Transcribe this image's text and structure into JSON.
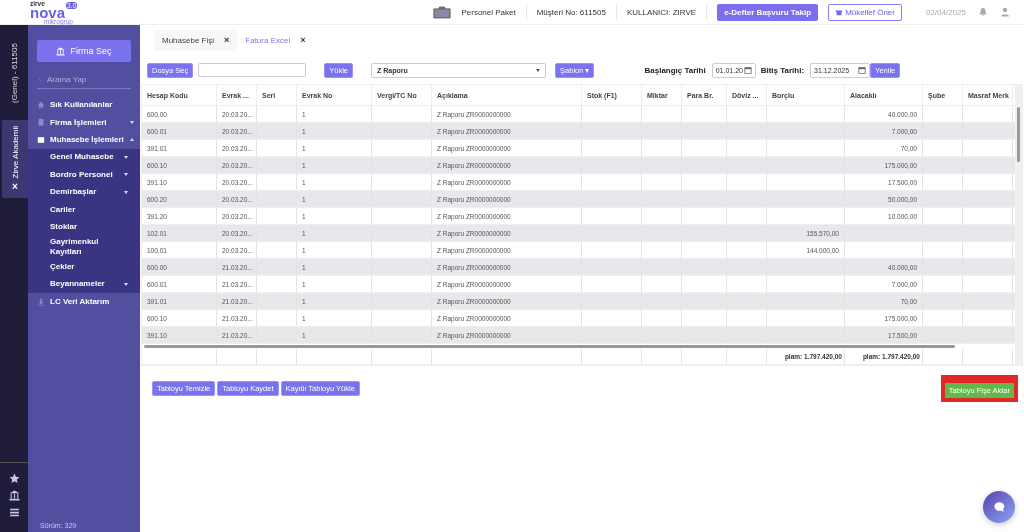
{
  "header": {
    "logo": {
      "brand_small": "zirve",
      "brand": "nova",
      "badge": "3.0",
      "sub": "mikrogrup"
    },
    "package": "Personel Paket",
    "customer_no": "Müşteri No: 611505",
    "user": "KULLANICI: ZIRVE",
    "edefter_button": "e-Defter Başvuru Takip",
    "recommend_button": "Mükellef Öner",
    "date": "02/04/2025"
  },
  "rail": {
    "company_label": "(Genel) - 611505",
    "tab": {
      "label": "Zirve Akademii",
      "close": "×"
    }
  },
  "sidebar": {
    "firm_button": "Firma Seç",
    "search": {
      "placeholder": "Arama Yap"
    },
    "items": [
      {
        "label": "Sık Kullanılanlar",
        "kind": "link"
      },
      {
        "label": "Firma İşlemleri",
        "kind": "group",
        "expanded": false
      },
      {
        "label": "Muhasebe İşlemleri",
        "kind": "group",
        "expanded": true,
        "children": [
          {
            "label": "Genel Muhasebe",
            "kind": "group",
            "expanded": false
          },
          {
            "label": "Bordro Personel",
            "kind": "group",
            "expanded": false
          },
          {
            "label": "Demirbaşlar",
            "kind": "group",
            "expanded": false
          },
          {
            "label": "Cariler",
            "kind": "link"
          },
          {
            "label": "Stoklar",
            "kind": "link"
          },
          {
            "label": "Gayrimenkul Kayıtları",
            "kind": "link"
          },
          {
            "label": "Çekler",
            "kind": "link"
          },
          {
            "label": "Beyannameler",
            "kind": "group",
            "expanded": false
          }
        ]
      },
      {
        "label": "LC Veri Aktarım",
        "kind": "link"
      }
    ],
    "version": "Sürüm: 329"
  },
  "tabs": [
    {
      "label": "Muhasebe Fişi",
      "close": "×",
      "selected": false
    },
    {
      "label": "Fatura Excel",
      "close": "×",
      "selected": true
    }
  ],
  "toolbar": {
    "file_button": "Dosya Seç",
    "load_button": "Yükle",
    "report_select": "Z Raporu",
    "template_button": "Şablon ▾",
    "start_label": "Başlangıç Tarihi",
    "start_date": "01.01.20",
    "end_label": "Bitiş Tarihi:",
    "end_date": "31.12.2025",
    "refresh_button": "Yenile"
  },
  "table": {
    "columns": [
      "Hesap Kodu",
      "Evrak ...",
      "Seri",
      "Evrak No",
      "Vergi/TC No",
      "Açıklama",
      "Stok (F1)",
      "Miktar",
      "Para Br.",
      "Döviz ...",
      "Borçlu",
      "Alacaklı",
      "Şube",
      "Masraf Merk"
    ],
    "rows": [
      {
        "hesap_kodu": "600.00",
        "evrak": "20.03.20...",
        "evrak_no": "1",
        "aciklama": "Z Raporu ZR0000000000",
        "alacakli": "40.000,00"
      },
      {
        "hesap_kodu": "600.01",
        "evrak": "20.03.20...",
        "evrak_no": "1",
        "aciklama": "Z Raporu ZR0000000000",
        "alacakli": "7.000,00"
      },
      {
        "hesap_kodu": "391.01",
        "evrak": "20.03.20...",
        "evrak_no": "1",
        "aciklama": "Z Raporu ZR0000000000",
        "alacakli": "70,00"
      },
      {
        "hesap_kodu": "600.10",
        "evrak": "20.03.20...",
        "evrak_no": "1",
        "aciklama": "Z Raporu ZR0000000000",
        "alacakli": "175.000,00"
      },
      {
        "hesap_kodu": "391.10",
        "evrak": "20.03.20...",
        "evrak_no": "1",
        "aciklama": "Z Raporu ZR0000000000",
        "alacakli": "17.500,00"
      },
      {
        "hesap_kodu": "600.20",
        "evrak": "20.03.20...",
        "evrak_no": "1",
        "aciklama": "Z Raporu ZR0000000000",
        "alacakli": "50.000,00"
      },
      {
        "hesap_kodu": "391.20",
        "evrak": "20.03.20...",
        "evrak_no": "1",
        "aciklama": "Z Raporu ZR0000000000",
        "alacakli": "10.000,00"
      },
      {
        "hesap_kodu": "102.01",
        "evrak": "20.03.20...",
        "evrak_no": "1",
        "aciklama": "Z Raporu ZR0000000000",
        "borclu": "155.570,00"
      },
      {
        "hesap_kodu": "100.01",
        "evrak": "20.03.20...",
        "evrak_no": "1",
        "aciklama": "Z Raporu ZR0000000000",
        "borclu": "144.000,00"
      },
      {
        "hesap_kodu": "600.00",
        "evrak": "21.03.20...",
        "evrak_no": "1",
        "aciklama": "Z Raporu ZR0000000000",
        "alacakli": "40.000,00"
      },
      {
        "hesap_kodu": "600.01",
        "evrak": "21.03.20...",
        "evrak_no": "1",
        "aciklama": "Z Raporu ZR0000000000",
        "alacakli": "7.000,00"
      },
      {
        "hesap_kodu": "391.01",
        "evrak": "21.03.20...",
        "evrak_no": "1",
        "aciklama": "Z Raporu ZR0000000000",
        "alacakli": "70,00"
      },
      {
        "hesap_kodu": "600.10",
        "evrak": "21.03.20...",
        "evrak_no": "1",
        "aciklama": "Z Raporu ZR0000000000",
        "alacakli": "175.000,00"
      },
      {
        "hesap_kodu": "391.10",
        "evrak": "21.03.20...",
        "evrak_no": "1",
        "aciklama": "Z Raporu ZR0000000000",
        "alacakli": "17.500,00"
      }
    ],
    "totals": {
      "borclu": "plam: 1.797.420,00",
      "alacakli": "plam: 1.797.420,00"
    }
  },
  "actions": [
    "Tabloyu Temizle",
    "Tabloyu Kaydet",
    "Kayıtlı Tabloyu Yükle"
  ],
  "export_button": {
    "label": "Tabloyu Fişe Aktar",
    "highlighted": true
  }
}
